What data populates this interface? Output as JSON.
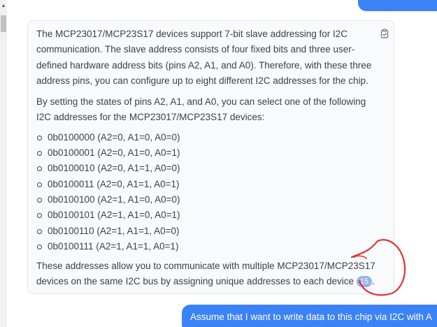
{
  "scrollbar": {
    "up_arrow": "▲"
  },
  "assistant_message": {
    "paragraph1": "The MCP23017/MCP23S17 devices support 7-bit slave addressing for I2C communication. The slave address consists of four fixed bits and three user-defined hardware address bits (pins A2, A1, and A0). Therefore, with these three address pins, you can configure up to eight different I2C addresses for the chip.",
    "paragraph2": "By setting the states of pins A2, A1, and A0, you can select one of the following I2C addresses for the MCP23017/MCP23S17 devices:",
    "addresses": [
      "0b0100000 (A2=0, A1=0, A0=0)",
      "0b0100001 (A2=0, A1=0, A0=1)",
      "0b0100010 (A2=0, A1=1, A0=0)",
      "0b0100011 (A2=0, A1=1, A0=1)",
      "0b0100100 (A2=1, A1=0, A0=0)",
      "0b0100101 (A2=1, A1=0, A0=1)",
      "0b0100110 (A2=1, A1=1, A0=0)",
      "0b0100111 (A2=1, A1=1, A0=1)"
    ],
    "paragraph3": "These addresses allow you to communicate with multiple MCP23017/MCP23S17 devices on the same I2C bus by assigning unique addresses to each device",
    "citation": "15",
    "paragraph3_end": ".",
    "copy_icon": "clipboard-icon"
  },
  "user_message": {
    "text": "Assume that I want to write data to this chip via I2C with A"
  },
  "colors": {
    "user_bubble": "#3b82f6",
    "card_background": "#f9fafb",
    "citation_badge": "#93b4e8",
    "annotation": "#e53030"
  }
}
